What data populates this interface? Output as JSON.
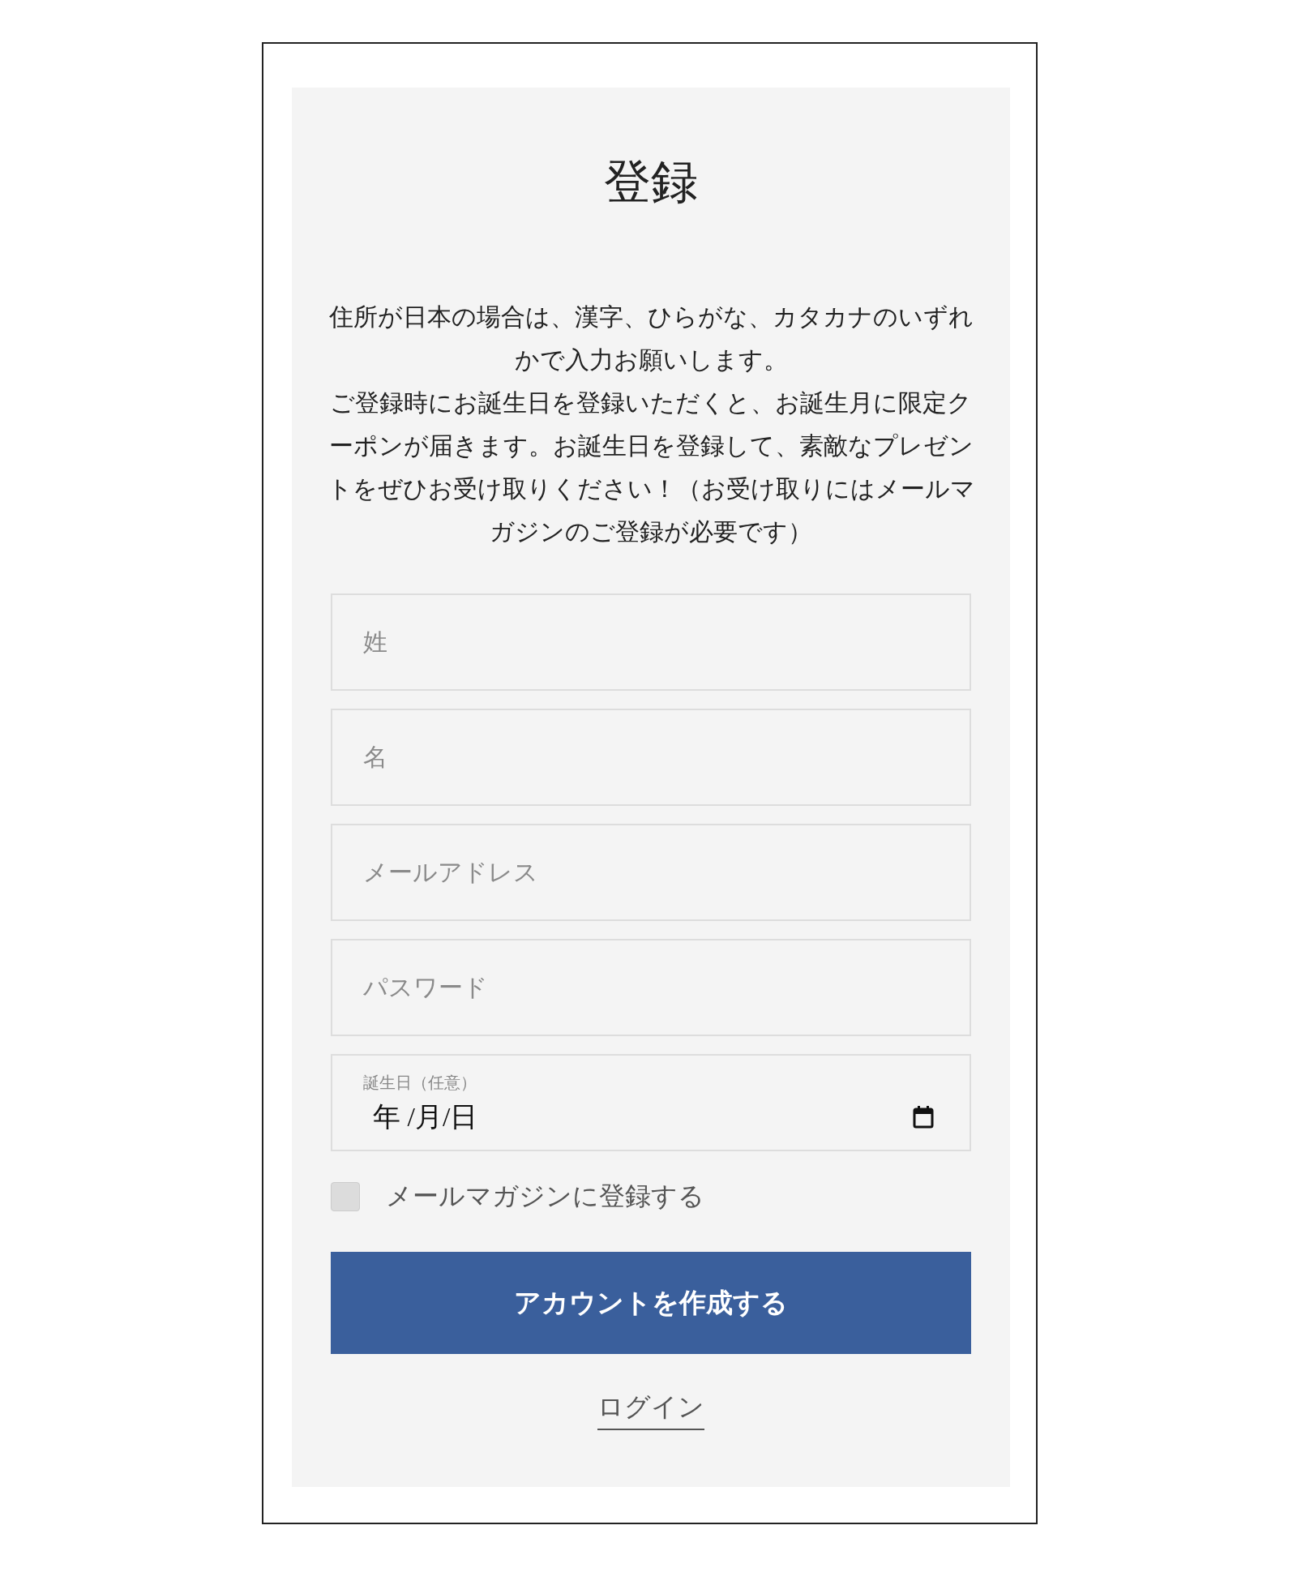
{
  "title": "登録",
  "description": [
    "住所が日本の場合は、漢字、ひらがな、カタカナのいずれかで入力お願いします。",
    "ご登録時にお誕生日を登録いただくと、お誕生月に限定クーポンが届きます。お誕生日を登録して、素敵なプレゼントをぜひお受け取りください！（お受け取りにはメールマガジンのご登録が必要です）"
  ],
  "fields": [
    {
      "kind": "text",
      "placeholder": "姓"
    },
    {
      "kind": "text",
      "placeholder": "名"
    },
    {
      "kind": "text",
      "placeholder": "メールアドレス"
    },
    {
      "kind": "text",
      "placeholder": "パスワード"
    },
    {
      "kind": "date",
      "label": "誕生日（任意）",
      "value": "年 /月/日"
    }
  ],
  "newsletter": {
    "label": "メールマガジンに登録する",
    "checked": false
  },
  "submit_button": "アカウントを作成する",
  "login_link": "ログイン"
}
